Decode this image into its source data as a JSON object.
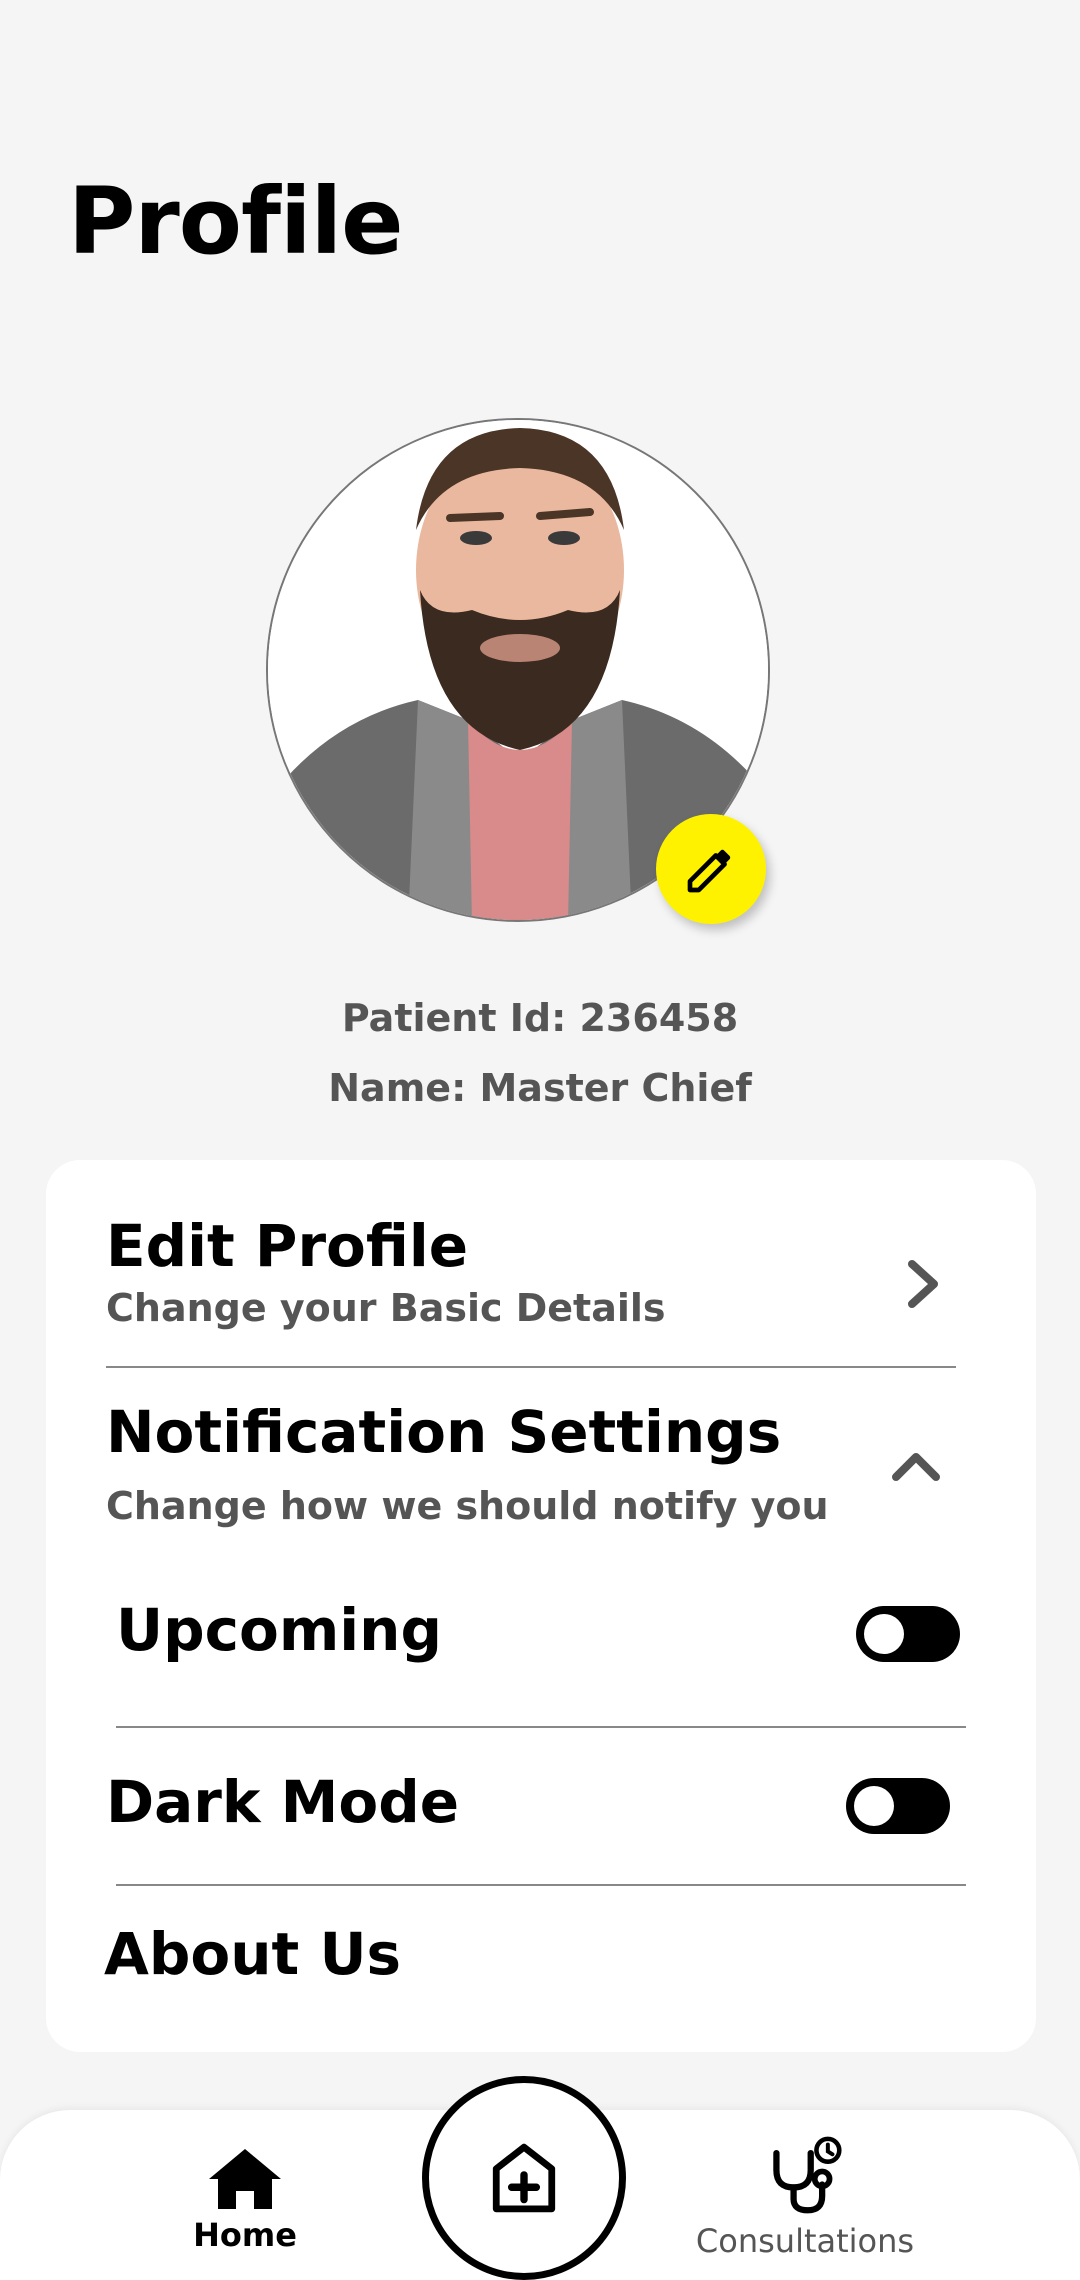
{
  "header": {
    "title": "Profile"
  },
  "profile": {
    "patient_id": "Patient Id: 236458",
    "name": "Name: Master Chief",
    "edit_avatar_icon": "pencil-icon"
  },
  "settings": {
    "edit_profile": {
      "title": "Edit Profile",
      "subtitle": "Change your Basic Details",
      "icon": "chevron-right-icon"
    },
    "notification_settings": {
      "title": "Notification Settings",
      "subtitle": "Change how we should notify you",
      "icon": "chevron-up-icon",
      "expanded": true
    },
    "upcoming": {
      "label": "Upcoming",
      "enabled": false
    },
    "dark_mode": {
      "label": "Dark Mode",
      "enabled": false
    },
    "about_us": {
      "label": "About Us"
    }
  },
  "bottom_nav": {
    "home": {
      "label": "Home",
      "icon": "home-icon",
      "active": true
    },
    "center": {
      "icon": "hospital-plus-icon"
    },
    "consultations": {
      "label": "Consultations",
      "icon": "stethoscope-history-icon"
    }
  },
  "colors": {
    "accent": "#fff200",
    "background": "#f5f5f5",
    "card": "#ffffff",
    "secondary_text": "#555555"
  }
}
